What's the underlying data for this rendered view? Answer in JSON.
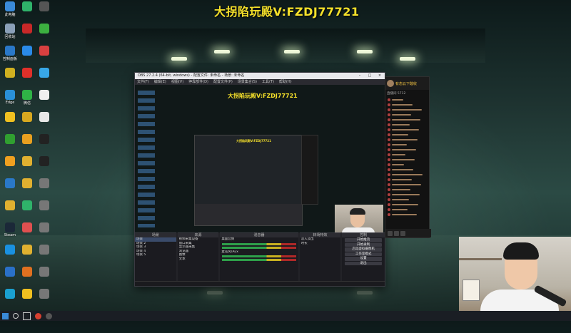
{
  "banner": "大拐陷玩殿V:FZDJ77721",
  "desktop": {
    "icons": [
      {
        "label": "此电脑",
        "color": "#3a8ad8"
      },
      {
        "label": "",
        "color": "#2fb36a"
      },
      {
        "label": "",
        "color": "#555"
      },
      {
        "label": "回收站",
        "color": "#8aa0b8"
      },
      {
        "label": "",
        "color": "#c82828"
      },
      {
        "label": "",
        "color": "#3cb040"
      },
      {
        "label": "控制面板",
        "color": "#2a78c8"
      },
      {
        "label": "",
        "color": "#2a8ae8"
      },
      {
        "label": "",
        "color": "#d84040"
      },
      {
        "label": "",
        "color": "#d0b020"
      },
      {
        "label": "",
        "color": "#e0302a"
      },
      {
        "label": "",
        "color": "#38a8e8"
      },
      {
        "label": "Edge",
        "color": "#2a90d8"
      },
      {
        "label": "微信",
        "color": "#2fb346"
      },
      {
        "label": "",
        "color": "#f0f0f0"
      },
      {
        "label": "",
        "color": "#f0c020"
      },
      {
        "label": "",
        "color": "#d8a820"
      },
      {
        "label": "",
        "color": "#e8e8e8"
      },
      {
        "label": "",
        "color": "#30a030"
      },
      {
        "label": "",
        "color": "#e8a020"
      },
      {
        "label": "",
        "color": "#222"
      },
      {
        "label": "",
        "color": "#f0a020"
      },
      {
        "label": "",
        "color": "#e0b030"
      },
      {
        "label": "",
        "color": "#222"
      },
      {
        "label": "",
        "color": "#2a78c8"
      },
      {
        "label": "",
        "color": "#e0b030"
      },
      {
        "label": "",
        "color": "#777"
      },
      {
        "label": "",
        "color": "#e0b030"
      },
      {
        "label": "",
        "color": "#2fb36a"
      },
      {
        "label": "",
        "color": "#777"
      },
      {
        "label": "Steam",
        "color": "#1b2838"
      },
      {
        "label": "",
        "color": "#e05050"
      },
      {
        "label": "",
        "color": "#777"
      },
      {
        "label": "",
        "color": "#1a90e0"
      },
      {
        "label": "",
        "color": "#e0b030"
      },
      {
        "label": "",
        "color": "#777"
      },
      {
        "label": "",
        "color": "#2a70c8"
      },
      {
        "label": "",
        "color": "#e07020"
      },
      {
        "label": "",
        "color": "#777"
      },
      {
        "label": "",
        "color": "#1aa0d0"
      },
      {
        "label": "",
        "color": "#f0c020"
      },
      {
        "label": "",
        "color": "#777"
      },
      {
        "label": "",
        "color": "#d82828"
      },
      {
        "label": "",
        "color": "#e8e8e8"
      },
      {
        "label": "",
        "color": "#777"
      }
    ]
  },
  "obs": {
    "title": "OBS 27.2.4 (64-bit, windows) - 配置文件: 未命名 - 场景: 未命名",
    "menu": [
      "文件(F)",
      "编辑(E)",
      "视图(V)",
      "停靠部件(D)",
      "配置文件(P)",
      "场景集合(S)",
      "工具(T)",
      "帮助(H)"
    ],
    "preview_banner": "大拐陷玩殿V:FZDJ77721",
    "docks": {
      "scenes": {
        "title": "场景",
        "items": [
          "场景",
          "场景 2",
          "场景 3",
          "场景 4",
          "场景 5"
        ]
      },
      "sources": {
        "title": "来源",
        "items": [
          "视频采集设备",
          "窗口采集",
          "显示器采集",
          "浏览器",
          "图像",
          "文本"
        ]
      },
      "mixer": {
        "title": "混音器",
        "channels": [
          "桌面音频",
          "麦克风/Aux"
        ]
      },
      "transitions": {
        "title": "转场特效",
        "items": [
          "淡入淡出",
          "时长"
        ]
      },
      "controls": {
        "title": "控制",
        "items": [
          "开始推流",
          "开始录制",
          "启动虚拟摄像机",
          "工作室模式",
          "设置",
          "退出"
        ]
      }
    }
  },
  "chat": {
    "header": "有态云下酸收",
    "count": "直播间 5712"
  },
  "taskbar": {
    "icons": [
      "start-icon",
      "search-icon",
      "task-view-icon",
      "browser-icon",
      "obs-icon"
    ]
  }
}
